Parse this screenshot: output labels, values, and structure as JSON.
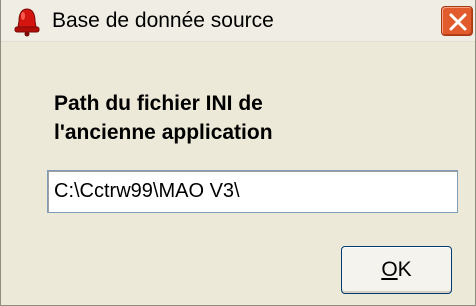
{
  "window": {
    "title": "Base de donnée source",
    "app_icon": "red-bell-icon",
    "close_icon": "close-icon"
  },
  "form": {
    "prompt_line1": "Path du fichier INI de",
    "prompt_line2": "l'ancienne application",
    "path_value": "C:\\Cctrw99\\MAO V3\\"
  },
  "buttons": {
    "ok_mnemonic": "O",
    "ok_rest": "K"
  },
  "colors": {
    "window_bg": "#ece9d8",
    "close_button": "#e25b2c",
    "button_border": "#003c74"
  }
}
